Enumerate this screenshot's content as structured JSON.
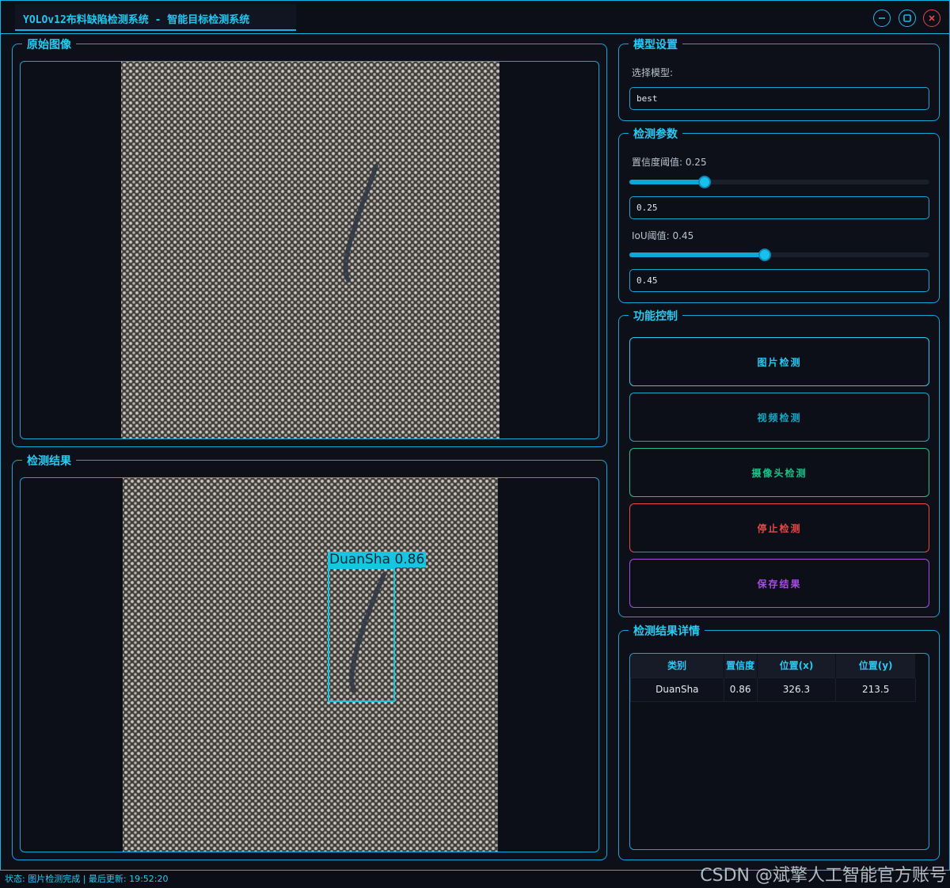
{
  "window": {
    "title": "YOLOv12布料缺陷检测系统 - 智能目标检测系统"
  },
  "panels": {
    "original_title": "原始图像",
    "result_title": "检测结果"
  },
  "detection_overlay": {
    "label": "DuanSha 0.86"
  },
  "model_settings": {
    "title": "模型设置",
    "select_label": "选择模型:",
    "model_value": "best"
  },
  "detect_params": {
    "title": "检测参数",
    "confidence_label": "置信度阈值: 0.25",
    "confidence_value": "0.25",
    "confidence_level": 0.25,
    "iou_label": "IoU阈值: 0.45",
    "iou_value": "0.45",
    "iou_level": 0.45
  },
  "function_control": {
    "title": "功能控制",
    "image_detect": "图片检测",
    "video_detect": "视频检测",
    "camera_detect": "摄像头检测",
    "stop_detect": "停止检测",
    "save_result": "保存结果"
  },
  "colors": {
    "accent": "#12b5e5",
    "image_btn": "#29c9f2",
    "video_btn": "#17a8c8",
    "camera_btn": "#19c28a",
    "stop_btn": "#e84848",
    "save_btn": "#a54ee0"
  },
  "results": {
    "title": "检测结果详情",
    "headers": [
      "类别",
      "置信度",
      "位置(x)",
      "位置(y)"
    ],
    "rows": [
      [
        "DuanSha",
        "0.86",
        "326.3",
        "213.5"
      ]
    ]
  },
  "status": {
    "text": "状态: 图片检测完成 | 最后更新: 19:52:20"
  },
  "watermark": "CSDN @斌擎人工智能官方账号"
}
